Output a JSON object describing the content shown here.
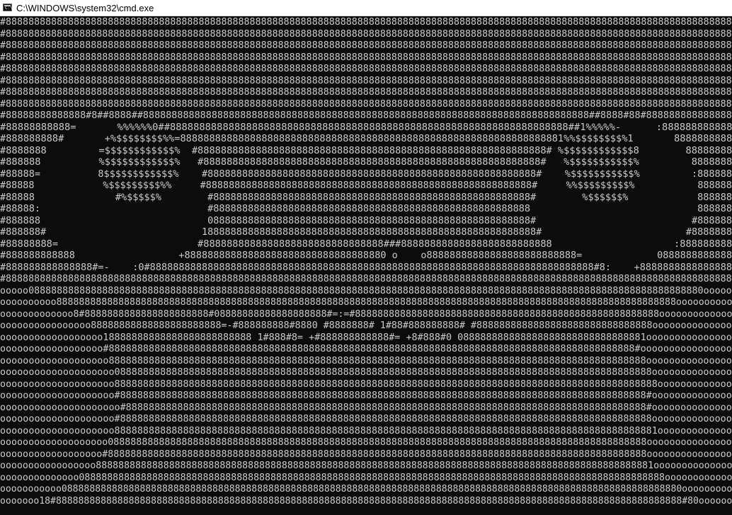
{
  "window": {
    "title": "C:\\WINDOWS\\system32\\cmd.exe",
    "icon": "cmd-icon"
  },
  "colors": {
    "background": "#0c0c0c",
    "text": "#cccccc",
    "titlebar": "#ffffff"
  },
  "console": {
    "lines": [
      "#88888888888888888888888888888888888888888888888888888888888888888888888888888888888888888888888888888888888888888888888888888888",
      "#88888888888888888888888888888888888888888888888888888888888888888888888888888888888888888888888888888888888888888888888888888888",
      "#88888888888888888888888888888888888888888888888888888888888888888888888888888888888888888888888888888888888888888888888888888888",
      "#88888888888888888888888888888888888888888888888888888888888888888888888888888888888888888888888888888888888888888888888888888888",
      "#88888888888888888888888888888888888888888888888888888888888888888888888888888888888888888888888888888888888888888888888888888888",
      "#88888888888888888888888888888888888888888888888888888888888888888888888888888888888888888888888888888888888888888888888888888888",
      "#88888888888888888888888888888888888888888888888888888888888888888888888888888888888888888888888888888888888888888888888888888888",
      "#88888888888888888888888888888888888888888888888888888888888888888888888888888888888888888888888888888888888888888888888888888888",
      "#88888888888888#8##8888##888888888888888888888888888888888888888888888888888888888888888888888888888888##8888#88#888888888888888",
      "#88888888888=       %%%%%%0##88888888888888888888888888888888888888888888888888888888888888888888##1%%%%%-      :888888888888",
      "#888888888#       +%$$$$$$$$%%=888888888888888888888888888888888888888888888888888888888888888881%%$$$$$$$$%1       8888888888",
      "#8888888         =$$$$$$$$$$$$%  #888888888888888888888888888888888888888888888888888888888888# %$$$$$$$$$$$$8        88888888",
      "#888888          %$$$$$$$$$$$$%   #8888888888888888888888888888888888888888888888888888888888#   %$$$$$$$$$$$%         8888888",
      "#88888=          8$$$$$$$$$$$$%    #888888888888888888888888888888888888888888888888888888888#    %$$$$$$$$$$$%         :888888",
      "#88888            %$$$$$$$$$%%     #888888888888888888888888888888888888888888888888888888888#     %%$$$$$$$$$%           888888",
      "#88888              #%$$$$$%        #8888888888888888888888888888888888888888888888888888888#        %$$$$$$%            888888",
      "#88888:                             #8888888888888888888888888888888888888888888888888888888                             888888",
      "#888888                             08888888888888888888888888888888888888888888888888888888#                           #888888",
      "#888888#                           1888888888888888888888888888888888888888888888888888888888#                         #8888888",
      "#88888888=                        #8888888888888888888888888888888###88888888888888888888888888                     :888888888",
      "#888888888888                  +88888888888888888888888888888888880 o    o88888888888888888888888888=             0888888888888",
      "#888888888888888#=-    :0#88888888888888888888888888888888888888888888888888888888888888888888888888888#8:    +8888888888888888",
      "#88888888888888888888888888888888888888888888888888888888888888888888888888888888888888888888888888888888888888888888888888888888",
      "ooooo08888888888888888888888888888888888888888888888888888888888888888888888888888888888888888888888888888888888888888888880ooooo",
      "oooooooooo88888888888888888888888888888888888888888888888888888888888888888888888888888888888888888888888888888888888888oooooooooo",
      "ooooooooooooo8#8888888888888888888888#08888888888888888888#=:=#888888888888888888888888888888888888888888888888888888ooooooooooooo",
      "oooooooooooooooo88888888888888888888888=-#888888888#8880 #8888888# 1#88#888888888# #8888888888888888888888888888888oooooooooooooo",
      "oooooooooooooooooo18888888888888888888888888 1#888#8= +#888888888888#= +8#888#0 088888888888888888888888888888881ooooooooooooooo",
      "oooooooooooooooooo#88888888888888888888888888888888888888888888888888888888888888888888888888888888888888888888#oooooooooooooooo",
      "ooooooooooooooooooo8888888888888888888888888888888888888888888888888888888888888888888888888888888888888888888888ooooooooooooooo",
      "oooooooooooooooooooo0888888888888888888888888888888888888888888888888888888888888888888888888888888888888888888888oooooooooooooo",
      "oooooooooooooooooooo88888888888888888888888888888888888888888888888888888888888888888888888888888888888888888888888ooooooooooooo",
      "oooooooooooooooooooo#88888888888888888888888888888888888888888888888888888888888888888888888888888888888888888888#oooooooooooooo",
      "ooooooooooooooooooooo#8888888888888888888888888888888888888888888888888888888888888888888888888888888888888888888#oooooooooooooo",
      "oooooooooooooooooooo#888888888888888888888888888888888888888888888888888888888888888888888888888888888888888888888oooooooooooooo",
      "oooooooooooooooooooo88888888888888888888888888888888888888888888888888888888888888888888888888888888888888888888881ooooooooooooo",
      "ooooooooooooooooooo08888888888888888888888888888888888888888888888888888888888888888888888888888888888888888888888ooooooooooooooo",
      "oooooooooooooooooo#88888888888888888888888888888888888888888888888888888888888888888888888888888888888888888888888ooooooooooooooo",
      "ooooooooooooooooo888888888888888888888888888888888888888888888888888888888888888888888888888888888888888888888888881oooooooooooooo",
      "oooooooooooooo08888888888888888888888888888888888888888888888888888888888888888888888888888888888888888888888888888888oooooooooooo",
      "ooooooooooo088888888888888888888888888888888888888888888888888888888888888888888888888888888888888888888888888888888888880ooooooooo",
      "ooooooo18#8888888888888888888888888888888888888888888888888888888888888888888888888888888888888888888888888888888888888888#80oooooo"
    ]
  }
}
